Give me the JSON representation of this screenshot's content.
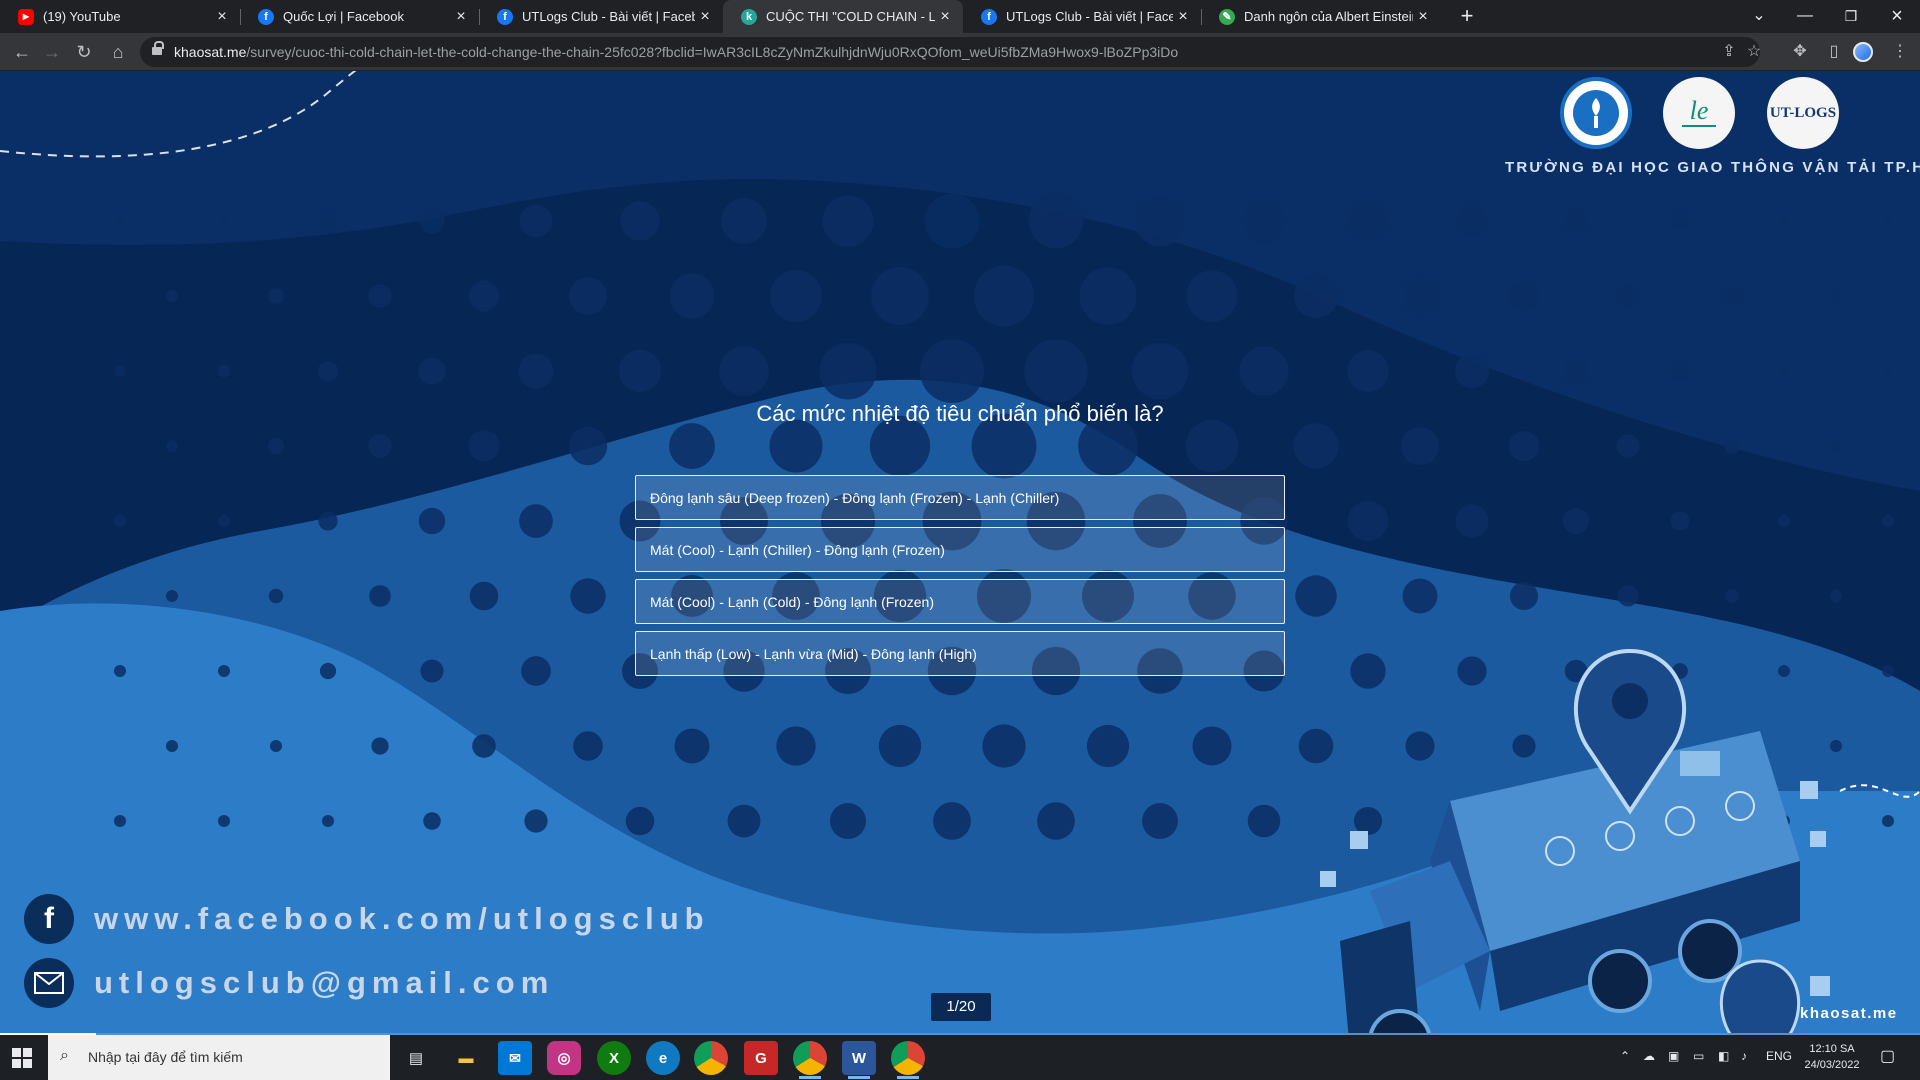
{
  "browser": {
    "tabs": [
      {
        "title": "(19) YouTube",
        "icon": "youtube-icon",
        "color": "#ff0000",
        "glyph": "▶",
        "active": false
      },
      {
        "title": "Quốc Lợi | Facebook",
        "icon": "facebook-icon",
        "color": "#1877f2",
        "glyph": "f",
        "active": false
      },
      {
        "title": "UTLogs Club - Bài viết | Facebook",
        "icon": "facebook-icon",
        "color": "#1877f2",
        "glyph": "f",
        "active": false
      },
      {
        "title": "CUỘC THI \"COLD CHAIN - LET TI",
        "icon": "khaosat-icon",
        "color": "#26a69a",
        "glyph": "k",
        "active": true
      },
      {
        "title": "UTLogs Club - Bài viết | Facebook",
        "icon": "facebook-icon",
        "color": "#1877f2",
        "glyph": "f",
        "active": false
      },
      {
        "title": "Danh ngôn của Albert Einstein",
        "icon": "quote-site-icon",
        "color": "#34a853",
        "glyph": "✎",
        "active": false
      }
    ],
    "new_tab": "+",
    "url_host": "khaosat.me",
    "url_path": "/survey/cuoc-thi-cold-chain-let-the-cold-change-the-chain-25fc028?fbclid=IwAR3cIL8cZyNmZkulhjdnWju0RxQOfom_weUi5fbZMa9Hwox9-lBoZPp3iDo"
  },
  "survey": {
    "university": "TRƯỜNG ĐẠI HỌC GIAO THÔNG VẬN TẢI TP.HCM",
    "logo_text": "UT-LOGS",
    "question": "Các mức nhiệt độ tiêu chuẩn phổ biến là?",
    "options": [
      "Đông lạnh sâu (Deep frozen) - Đông lạnh (Frozen) - Lạnh (Chiller)",
      "Mát (Cool) - Lạnh (Chiller) - Đông lạnh (Frozen)",
      "Mát (Cool) - Lạnh (Cold) - Đông lạnh (Frozen)",
      "Lạnh thấp (Low) - Lạnh vừa (Mid) - Đông lạnh (High)"
    ],
    "facebook": "www.facebook.com/utlogsclub",
    "email": "utlogsclub@gmail.com",
    "counter": "1/20",
    "progress": 0.05,
    "brand": "khaosat.me"
  },
  "taskbar": {
    "search_placeholder": "Nhập tại đây để tìm kiếm",
    "lang": "ENG",
    "time": "12:10 SA",
    "date": "24/03/2022"
  },
  "colors": {
    "page_bg": "#1c5aa0",
    "dark_navy": "#0a2a55",
    "light_blue": "#2a78c4"
  }
}
